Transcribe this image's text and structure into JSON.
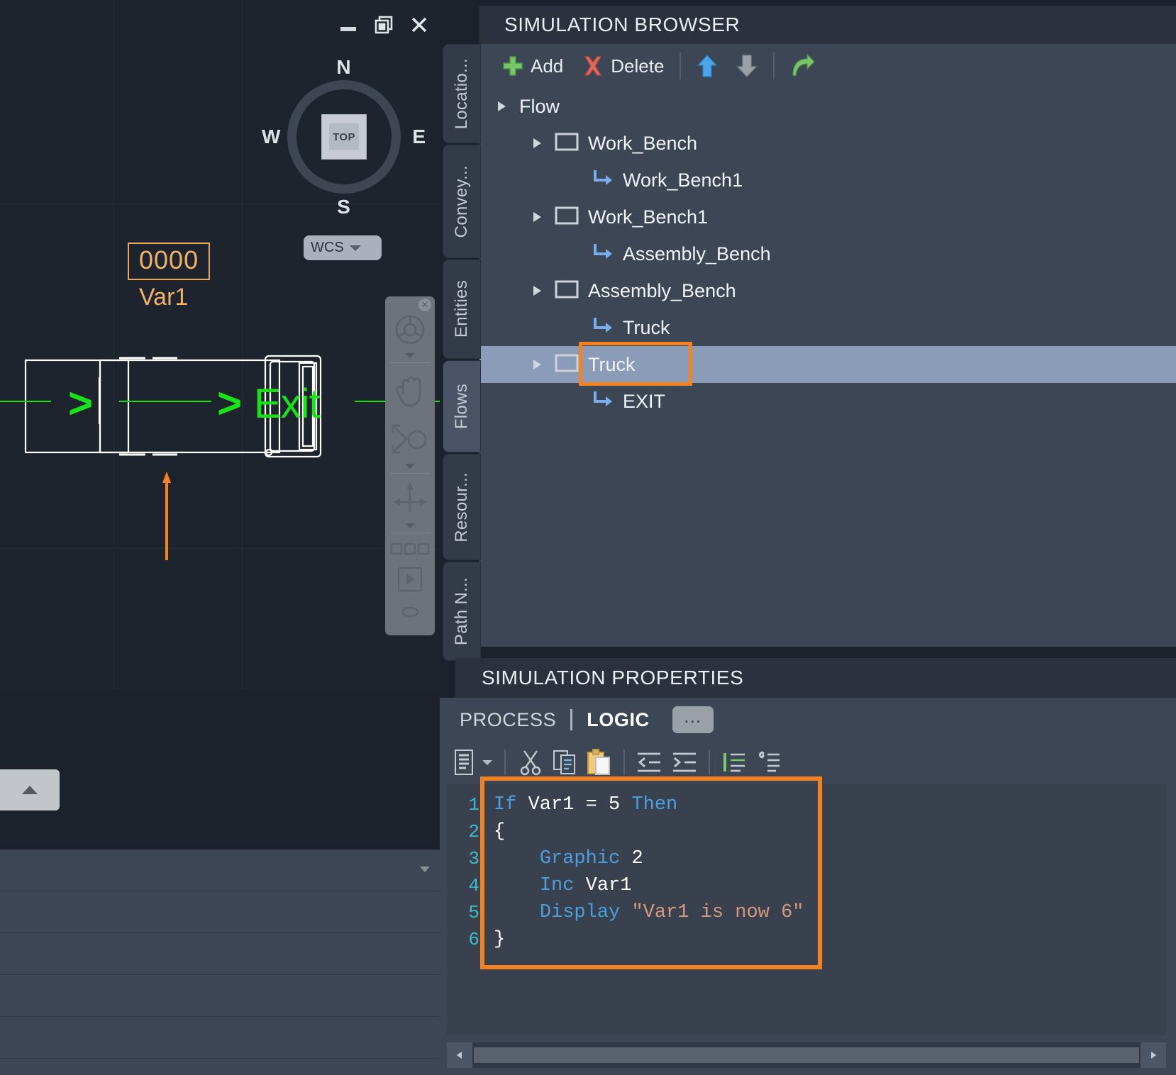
{
  "window_controls": [
    {
      "name": "minimize",
      "icon": "minimize-icon"
    },
    {
      "name": "restore",
      "icon": "restore-icon"
    },
    {
      "name": "close",
      "icon": "close-icon"
    }
  ],
  "viewport": {
    "viewcube": {
      "top_face": "TOP",
      "north": "N",
      "south": "S",
      "west": "W",
      "east": "E"
    },
    "wcs": {
      "label": "WCS"
    },
    "variable_display": {
      "value": "0000",
      "name": "Var1"
    },
    "flow_label": "Exit",
    "chevrons": [
      ">",
      ">",
      ">"
    ]
  },
  "browser": {
    "title": "SIMULATION BROWSER",
    "toolbar": {
      "add_label": "Add",
      "delete_label": "Delete",
      "move_up": "move-up-icon",
      "move_down": "move-down-icon",
      "goto": "goto-icon"
    },
    "tree": [
      {
        "label": "Flow",
        "indent": 0,
        "type": "root",
        "expander": true,
        "selected": false
      },
      {
        "label": "Work_Bench",
        "indent": 1,
        "type": "node",
        "expander": true,
        "selected": false
      },
      {
        "label": "Work_Bench1",
        "indent": 2,
        "type": "link",
        "expander": false,
        "selected": false
      },
      {
        "label": "Work_Bench1",
        "indent": 1,
        "type": "node",
        "expander": true,
        "selected": false
      },
      {
        "label": "Assembly_Bench",
        "indent": 2,
        "type": "link",
        "expander": false,
        "selected": false
      },
      {
        "label": "Assembly_Bench",
        "indent": 1,
        "type": "node",
        "expander": true,
        "selected": false
      },
      {
        "label": "Truck",
        "indent": 2,
        "type": "link",
        "expander": false,
        "selected": false
      },
      {
        "label": "Truck",
        "indent": 1,
        "type": "node",
        "expander": true,
        "selected": true
      },
      {
        "label": "EXIT",
        "indent": 2,
        "type": "link",
        "expander": false,
        "selected": false
      }
    ]
  },
  "tabs": [
    {
      "label": "Locatio...",
      "active": false
    },
    {
      "label": "Convey...",
      "active": false
    },
    {
      "label": "Entities",
      "active": false
    },
    {
      "label": "Flows",
      "active": true
    },
    {
      "label": "Resour...",
      "active": false
    },
    {
      "label": "Path N...",
      "active": false
    }
  ],
  "properties": {
    "title": "SIMULATION PROPERTIES",
    "tabs": [
      {
        "label": "PROCESS",
        "active": false
      },
      {
        "label": "LOGIC",
        "active": true
      }
    ],
    "overflow_label": "...",
    "editor_toolbar": [
      {
        "name": "insert-statement-icon"
      },
      {
        "name": "cut-icon"
      },
      {
        "name": "copy-icon"
      },
      {
        "name": "paste-icon"
      },
      {
        "name": "outdent-icon"
      },
      {
        "name": "indent-icon"
      },
      {
        "name": "comment-icon"
      },
      {
        "name": "uncomment-icon"
      }
    ],
    "code": {
      "line_numbers": [
        "1",
        "2",
        "3",
        "4",
        "5",
        "6"
      ],
      "lines": [
        {
          "n": "1",
          "tokens": [
            {
              "t": "If ",
              "c": "kw"
            },
            {
              "t": "Var1 ",
              "c": "pl"
            },
            {
              "t": "= ",
              "c": "pl"
            },
            {
              "t": "5 ",
              "c": "pl"
            },
            {
              "t": "Then",
              "c": "kw"
            }
          ]
        },
        {
          "n": "2",
          "tokens": [
            {
              "t": "{",
              "c": "pl"
            }
          ]
        },
        {
          "n": "3",
          "tokens": [
            {
              "t": "    ",
              "c": "pl"
            },
            {
              "t": "Graphic ",
              "c": "kw"
            },
            {
              "t": "2",
              "c": "pl"
            }
          ]
        },
        {
          "n": "4",
          "tokens": [
            {
              "t": "    ",
              "c": "pl"
            },
            {
              "t": "Inc ",
              "c": "kw"
            },
            {
              "t": "Var1",
              "c": "pl"
            }
          ]
        },
        {
          "n": "5",
          "tokens": [
            {
              "t": "    ",
              "c": "pl"
            },
            {
              "t": "Display ",
              "c": "kw"
            },
            {
              "t": "\"Var1 is now 6\"",
              "c": "str"
            }
          ]
        },
        {
          "n": "6",
          "tokens": [
            {
              "t": "}",
              "c": "pl"
            }
          ]
        }
      ],
      "plain_text": "If Var1 = 5 Then\n{\n    Graphic 2\n    Inc Var1\n    Display \"Var1 is now 6\"\n}"
    }
  },
  "annotations": {
    "highlight_color": "#f58220",
    "highlighted_tree_node": "Truck",
    "highlighted_code_block": "If Var1 = 5 Then { Graphic 2 Inc Var1 Display \"Var1 is now 6\" }"
  },
  "colors": {
    "accent_orange": "#f58220",
    "flow_green": "#19e219",
    "var_orange": "#f2b169",
    "selection_blue": "#8b9cb8",
    "panel_bg": "#3d4654",
    "viewport_bg": "#1d242e"
  }
}
